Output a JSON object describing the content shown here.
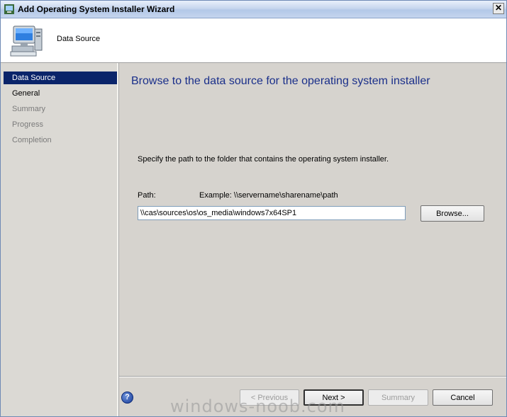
{
  "window": {
    "title": "Add Operating System Installer Wizard",
    "close_glyph": "✕"
  },
  "header": {
    "title": "Data Source"
  },
  "sidebar": {
    "items": [
      {
        "label": "Data Source",
        "state": "selected"
      },
      {
        "label": "General",
        "state": "done"
      },
      {
        "label": "Summary",
        "state": "pending"
      },
      {
        "label": "Progress",
        "state": "pending"
      },
      {
        "label": "Completion",
        "state": "pending"
      }
    ]
  },
  "main": {
    "title": "Browse to the data source for the operating system installer",
    "instruction": "Specify the path to the folder that contains the operating system installer.",
    "path_label": "Path:",
    "example": "Example: \\\\servername\\sharename\\path",
    "path_value": "\\\\cas\\sources\\os\\os_media\\windows7x64SP1",
    "browse_label": "Browse..."
  },
  "footer": {
    "help_glyph": "?",
    "previous_label": "< Previous",
    "next_label": "Next >",
    "summary_label": "Summary",
    "cancel_label": "Cancel"
  },
  "watermark": "windows-noob.com",
  "colors": {
    "selected_bg": "#0a246a",
    "title_text": "#1a2f8a",
    "disabled_text": "#9c9c9c"
  }
}
